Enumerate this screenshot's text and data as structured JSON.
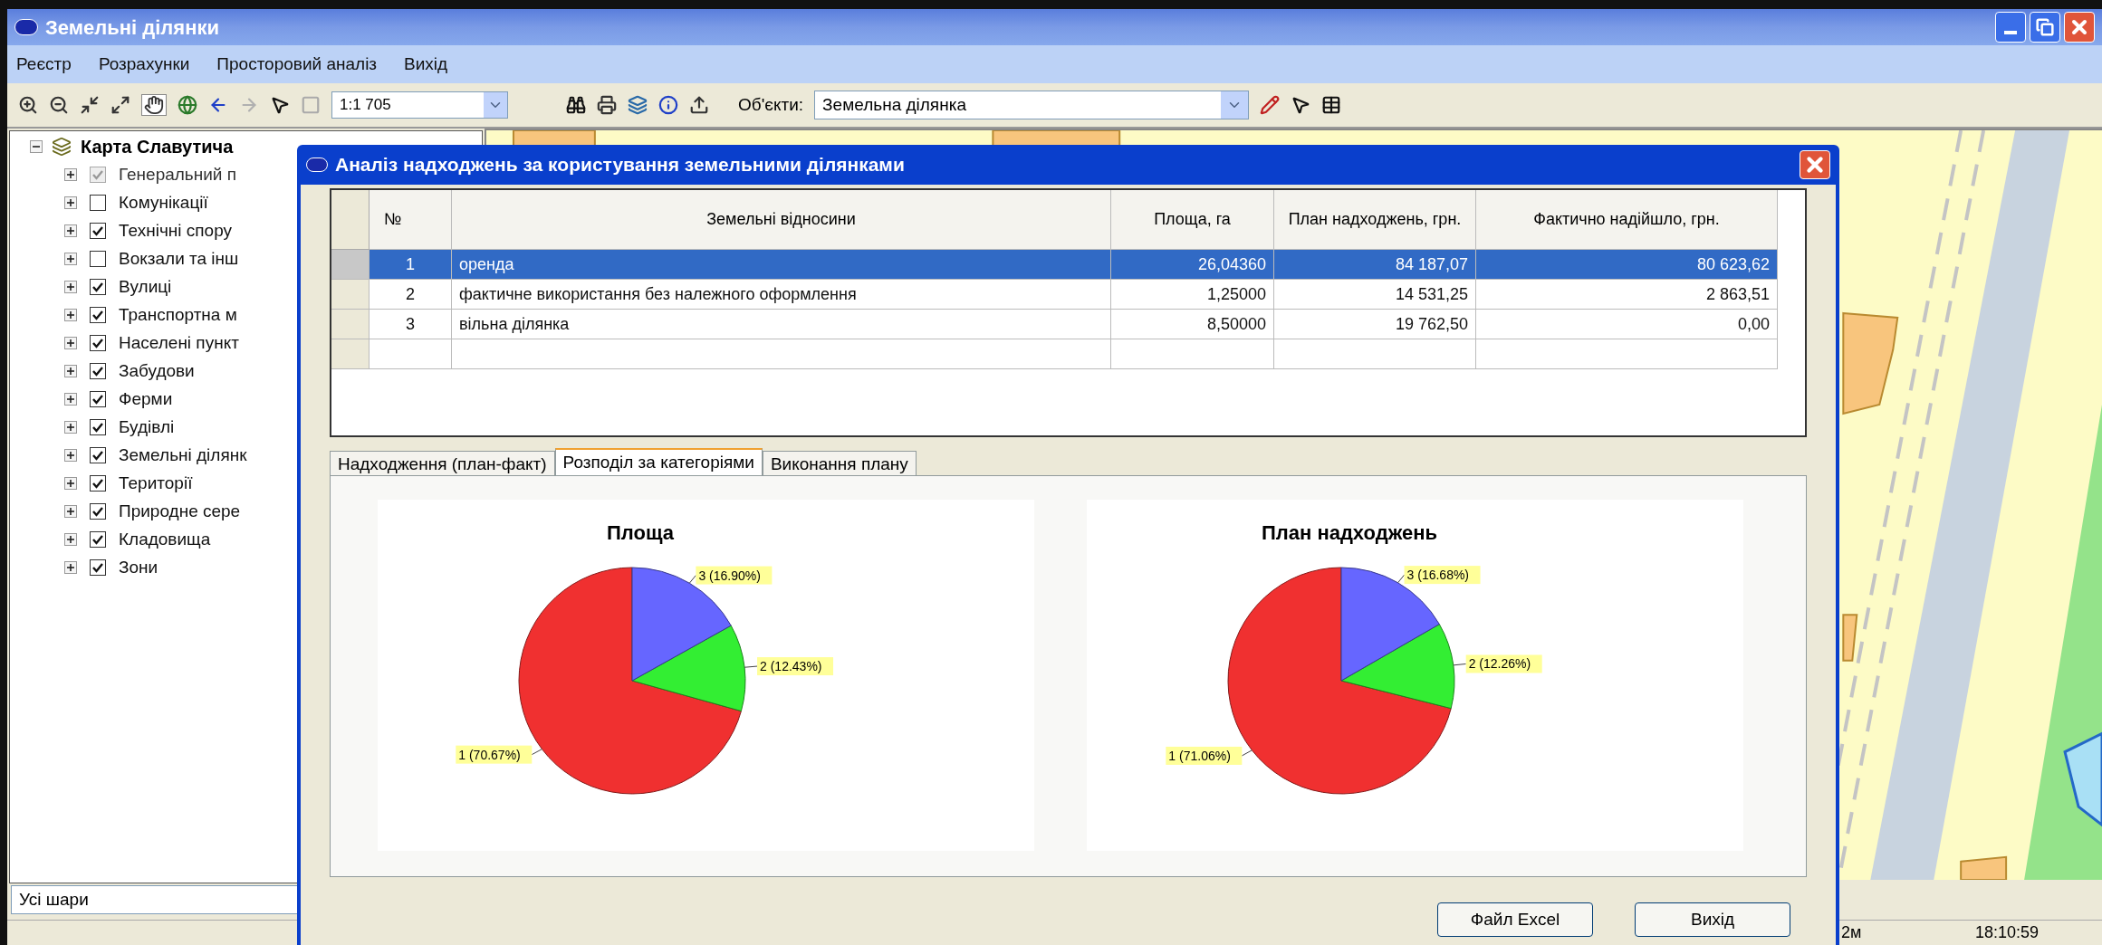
{
  "window": {
    "title": "Земельні ділянки"
  },
  "menu": [
    "Реєстр",
    "Розрахунки",
    "Просторовий аналіз",
    "Вихід"
  ],
  "toolbar": {
    "scale": "1:1 705",
    "objects_label": "Об'єкти:",
    "objects_value": "Земельна ділянка"
  },
  "tree": [
    {
      "label": "Карта Славутича",
      "expanded": true,
      "children": [
        {
          "label": "Генеральний п",
          "checked": true,
          "disabled": true
        },
        {
          "label": "Комунікації",
          "checked": false,
          "disabled": false
        },
        {
          "label": "Технічні спору",
          "checked": true,
          "disabled": false
        },
        {
          "label": "Вокзали та інш",
          "checked": false,
          "disabled": false
        },
        {
          "label": "Вулиці",
          "checked": true,
          "disabled": false
        },
        {
          "label": "Транспортна м",
          "checked": true,
          "disabled": false
        },
        {
          "label": "Населені пункт",
          "checked": true,
          "disabled": false
        },
        {
          "label": "Забудови",
          "checked": true,
          "disabled": false
        },
        {
          "label": "Ферми",
          "checked": true,
          "disabled": false
        },
        {
          "label": "Будівлі",
          "checked": true,
          "disabled": false
        },
        {
          "label": "Земельні ділянк",
          "checked": true,
          "disabled": false
        },
        {
          "label": "Території",
          "checked": true,
          "disabled": false
        },
        {
          "label": "Природне сере",
          "checked": true,
          "disabled": false
        },
        {
          "label": "Кладовища",
          "checked": true,
          "disabled": false
        },
        {
          "label": "Зони",
          "checked": true,
          "disabled": false
        }
      ]
    }
  ],
  "layer_filter": {
    "value": "Усі шари"
  },
  "map": {
    "kind": "map"
  },
  "status_bar": [
    "2м",
    "18:10:59"
  ],
  "dialog": {
    "title": "Аналіз надходжень за користування земельними ділянками",
    "table": {
      "columns": [
        "№",
        "Земельні відносини",
        "Площа, га",
        "План надходжень, грн.",
        "Фактично надійшло, грн."
      ],
      "rows": [
        {
          "cells": [
            "1",
            "оренда",
            "26,04360",
            "84 187,07",
            "80 623,62"
          ],
          "selected": true
        },
        {
          "cells": [
            "2",
            "фактичне використання без належного оформлення",
            "1,25000",
            "14 531,25",
            "2 863,51"
          ],
          "selected": false
        },
        {
          "cells": [
            "3",
            "вільна ділянка",
            "8,50000",
            "19 762,50",
            "0,00"
          ],
          "selected": false
        }
      ]
    },
    "tabs": [
      {
        "label": "Надходження (план-факт)",
        "selected": false
      },
      {
        "label": "Розподіл за категоріями",
        "selected": true
      },
      {
        "label": "Виконання плану",
        "selected": false
      }
    ],
    "charts": [
      {
        "chart_data": {
          "type": "pie",
          "title": "Площа",
          "colors": [
            "#f03030",
            "#33ee33",
            "#6666ff"
          ],
          "values": [
            70.67,
            12.43,
            16.9
          ],
          "value_labels": [
            "1 (70.67%)",
            "2 (12.43%)",
            "3 (16.90%)"
          ]
        }
      },
      {
        "chart_data": {
          "type": "pie",
          "title": "План надходжень",
          "colors": [
            "#f03030",
            "#33ee33",
            "#6666ff"
          ],
          "values": [
            71.06,
            12.26,
            16.68
          ],
          "value_labels": [
            "1 (71.06%)",
            "2 (12.26%)",
            "3 (16.68%)"
          ]
        }
      }
    ],
    "buttons": [
      "Файл Excel",
      "Вихід"
    ]
  }
}
